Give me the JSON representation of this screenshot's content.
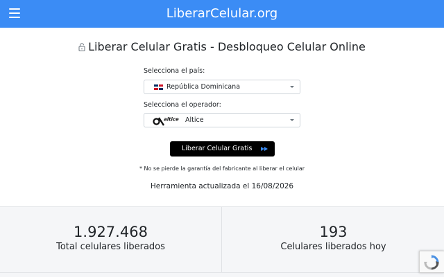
{
  "navbar": {
    "brand": "LiberarCelular.org",
    "menu_icon": "hamburger-menu-icon",
    "background": "#3b8cf5"
  },
  "main": {
    "title": "Liberar Celular Gratis - Desbloqueo Celular Online",
    "title_icon": "unlock-icon",
    "country_label": "Selecciona el país:",
    "country_selected": "República Dominicana",
    "country_flag": "dominican-republic-flag-icon",
    "operator_label": "Selecciona el operador:",
    "operator_selected": "Altice",
    "operator_logo": "altice-logo",
    "operator_logo_text": "altice",
    "submit_label": "Liberar Celular Gratis",
    "submit_icon": "fast-forward-icon",
    "warranty_note": "* No se pierde la garantía del fabricante al liberar el celular",
    "updated_text": "Herramienta actualizada el 16/08/2026"
  },
  "stats": [
    {
      "value": "1.927.468",
      "label": "Total celulares liberados"
    },
    {
      "value": "193",
      "label": "Celulares liberados hoy"
    }
  ],
  "recaptcha": {
    "icon": "recaptcha-icon"
  }
}
